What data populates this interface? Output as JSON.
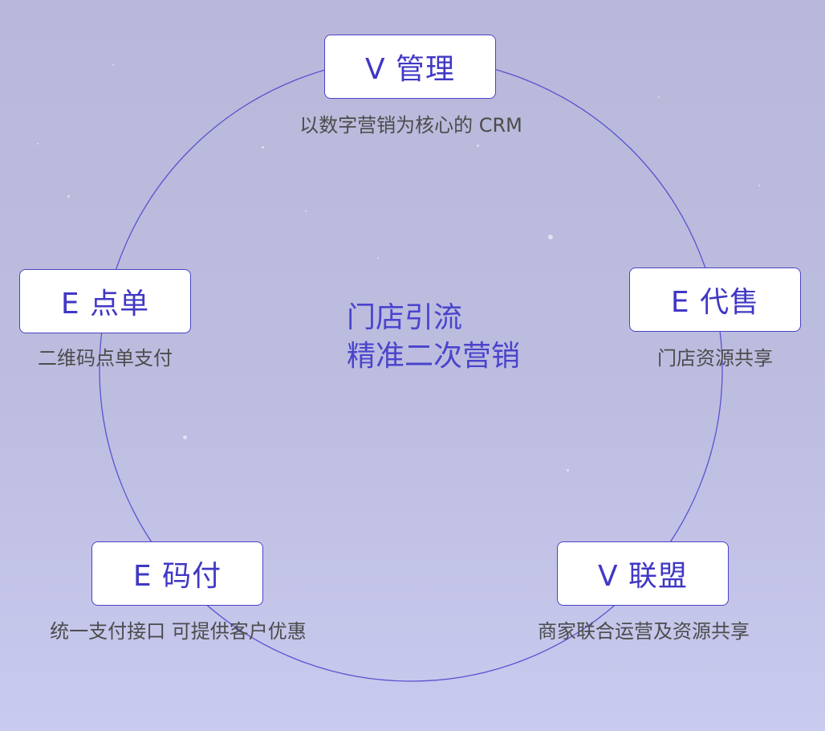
{
  "center": {
    "line1": "门店引流",
    "line2": "精准二次营销"
  },
  "nodes": [
    {
      "label": "V 管理",
      "desc": "以数字营销为核心的 CRM"
    },
    {
      "label": "E 代售",
      "desc": "门店资源共享"
    },
    {
      "label": "V 联盟",
      "desc": "商家联合运营及资源共享"
    },
    {
      "label": "E 码付",
      "desc": "统一支付接口 可提供客户优惠"
    },
    {
      "label": "E 点单",
      "desc": "二维码点单支付"
    }
  ],
  "colors": {
    "accent": "#4038c4",
    "ring": "#5a52d0",
    "background_top": "#b9b8da",
    "background_bottom": "#c8caef",
    "description_text": "#4c4c4c"
  }
}
